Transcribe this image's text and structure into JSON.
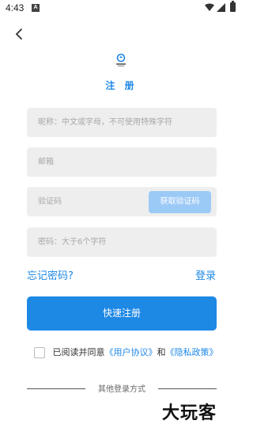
{
  "status": {
    "time": "4:43",
    "notification_letter": "A"
  },
  "header": {
    "title": "注 册"
  },
  "form": {
    "nickname_placeholder": "昵称：中文或字母，不可使用特殊字符",
    "email_placeholder": "邮箱",
    "code_placeholder": "验证码",
    "get_code_label": "获取验证码",
    "password_placeholder": "密码：大于6个字符"
  },
  "links": {
    "forgot_password": "忘记密码?",
    "login": "登录"
  },
  "submit_label": "快速注册",
  "agreement": {
    "prefix": "已阅读并同意",
    "user_agreement": "《用户协议》",
    "and": "和",
    "privacy_policy": "《隐私政策》",
    "checked": false
  },
  "other_login": "其他登录方式",
  "watermark": "大玩客",
  "colors": {
    "accent": "#1e88e5",
    "button_disabled": "#9ccaf6",
    "field_bg": "#eeeeee"
  }
}
